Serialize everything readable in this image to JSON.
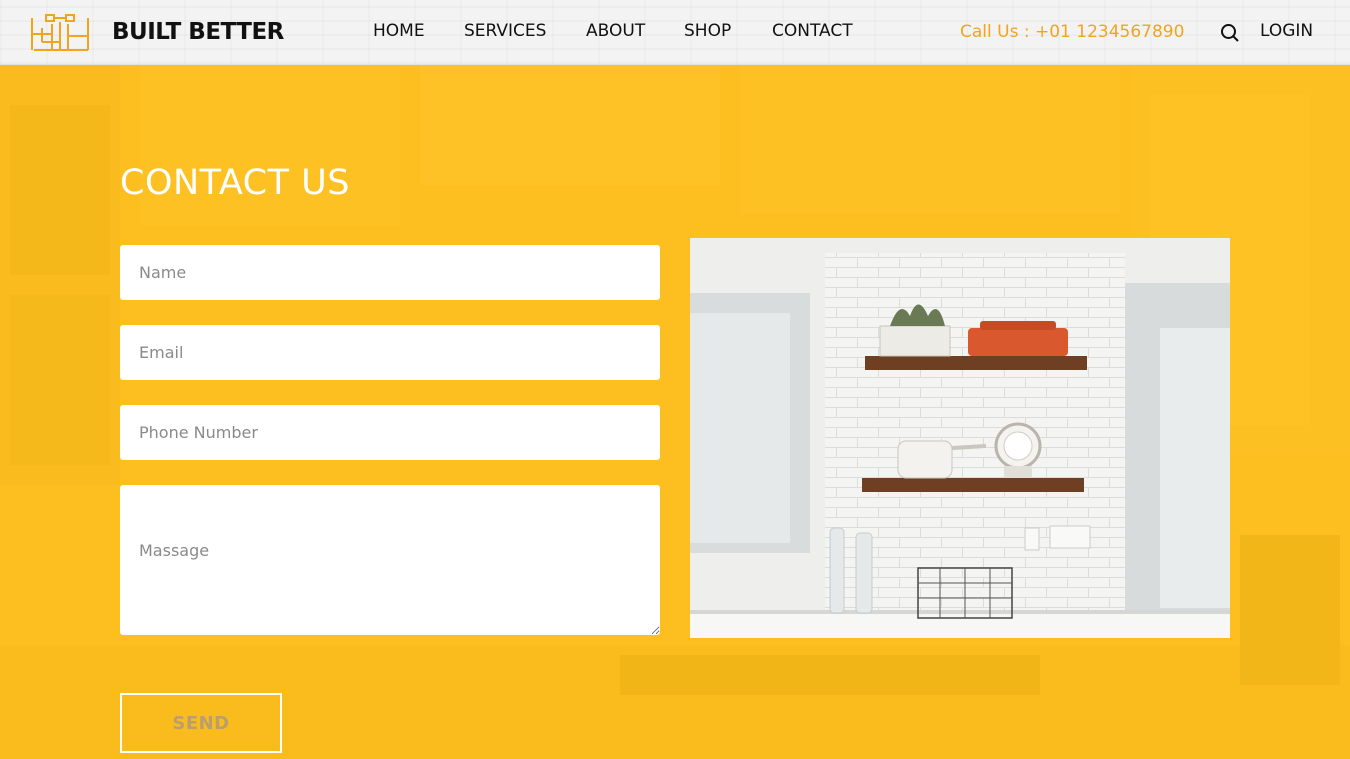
{
  "header": {
    "brand": "BUILT BETTER",
    "nav": [
      {
        "id": "home",
        "label": "HOME"
      },
      {
        "id": "services",
        "label": "SERVICES"
      },
      {
        "id": "about",
        "label": "ABOUT"
      },
      {
        "id": "shop",
        "label": "SHOP"
      },
      {
        "id": "contact",
        "label": "CONTACT"
      }
    ],
    "call": "Call Us : +01 1234567890",
    "login": "LOGIN",
    "search_icon": "search-icon"
  },
  "contact": {
    "title": "CONTACT US",
    "fields": {
      "name": "Name",
      "email": "Email",
      "phone": "Phone Number",
      "message": "Massage"
    },
    "send": "SEND"
  },
  "colors": {
    "accent": "#f6b91c",
    "call_text": "#f2a41d",
    "logo": "#f2a41d"
  }
}
